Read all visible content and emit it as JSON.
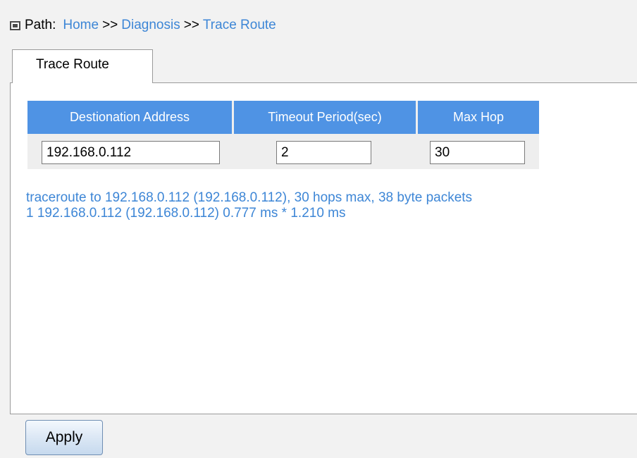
{
  "breadcrumb": {
    "label": "Path:",
    "items": [
      "Home",
      "Diagnosis",
      "Trace Route"
    ],
    "separator": ">>"
  },
  "tab": {
    "label": "Trace Route"
  },
  "form": {
    "columns": [
      "Destionation Address",
      "Timeout Period(sec)",
      "Max Hop"
    ],
    "values": {
      "destination": "192.168.0.112",
      "timeout": "2",
      "max_hop": "30"
    }
  },
  "output": {
    "lines": [
      "traceroute to 192.168.0.112 (192.168.0.112), 30 hops max, 38 byte packets",
      "1 192.168.0.112 (192.168.0.112) 0.777 ms * 1.210 ms"
    ]
  },
  "buttons": {
    "apply": "Apply"
  },
  "colors": {
    "link": "#3d86d6",
    "header_bg": "#4f93e4",
    "page_bg": "#f2f2f2"
  }
}
